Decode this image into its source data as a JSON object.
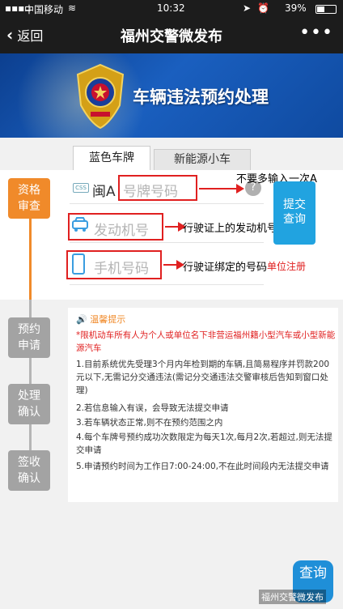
{
  "status_bar": {
    "carrier": "中国移动",
    "wifi_icon": "wifi-icon",
    "time": "10:32",
    "battery": "39%"
  },
  "nav": {
    "back_label": "返回",
    "title": "福州交警微发布",
    "more_label": "•••"
  },
  "banner": {
    "title": "车辆违法预约处理"
  },
  "tabs": [
    {
      "label": "蓝色车牌",
      "active": true
    },
    {
      "label": "新能源小车",
      "active": false
    }
  ],
  "steps": [
    {
      "label_top": "资格",
      "label_bottom": "审查",
      "active": true
    },
    {
      "label_top": "预约",
      "label_bottom": "申请",
      "active": false
    },
    {
      "label_top": "处理",
      "label_bottom": "确认",
      "active": false
    },
    {
      "label_top": "签收",
      "label_bottom": "确认",
      "active": false
    }
  ],
  "form": {
    "plate_badge": "CSS",
    "plate_prefix": "闽A",
    "plate_placeholder": "号牌号码",
    "engine_placeholder": "发动机号",
    "phone_placeholder": "手机号码",
    "help_symbol": "?",
    "submit_label_top": "提交",
    "submit_label_bottom": "查询",
    "unit_register": "单位注册"
  },
  "annotations": {
    "plate": "不要多输入一次A",
    "engine": "行驶证上的发动机号码",
    "phone": "行驶证绑定的号码"
  },
  "tips": {
    "title": "温馨提示",
    "warning": "*限机动车所有人为个人或单位名下非营运福州籍小型汽车或小型新能源汽车",
    "items": [
      "1.目前系统优先受理3个月内年检到期的车辆,且简易程序并罚款200元以下,无需记分交通违法(需记分交通违法交警审核后告知到窗口处理)",
      "2.若信息输入有误，会导致无法提交申请",
      "3.若车辆状态正常,则不在预约范围之内",
      "4.每个车牌号预约成功次数限定为每天1次,每月2次,若超过,则无法提交申请",
      "5.申请预约时间为工作日7:00-24:00,不在此时间段内无法提交申请"
    ]
  },
  "query_button": {
    "label_top": "查询"
  },
  "watermark": "福州交警微发布"
}
